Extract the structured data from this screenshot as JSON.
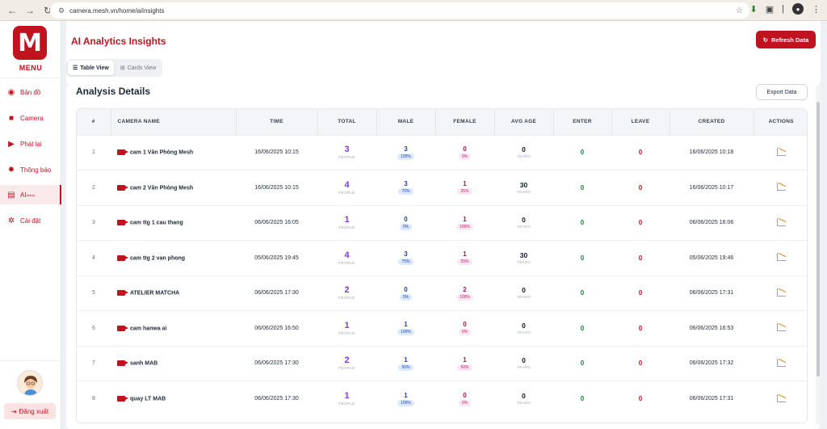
{
  "browser": {
    "url": "camera.mesh.vn/home/aiInsights"
  },
  "sidebar": {
    "logo_letter": "M",
    "menu_title": "MENU",
    "items": [
      {
        "label": "Bản đồ",
        "icon": "map-icon"
      },
      {
        "label": "Camera",
        "icon": "camera-icon"
      },
      {
        "label": "Phát lại",
        "icon": "playback-icon"
      },
      {
        "label": "Thông báo",
        "icon": "bell-icon"
      },
      {
        "label": "AI",
        "badge": "(beta)",
        "icon": "ai-icon"
      },
      {
        "label": "Cài đặt",
        "icon": "gear-icon"
      }
    ],
    "logout_label": "Đăng xuất"
  },
  "header": {
    "title": "AI Analytics Insights",
    "refresh_label": "Refresh Data",
    "views": [
      {
        "label": "Table View",
        "active": true
      },
      {
        "label": "Cards View",
        "active": false
      }
    ]
  },
  "section": {
    "title": "Analysis Details",
    "export_label": "Export Data"
  },
  "table": {
    "columns": [
      "#",
      "CAMERA NAME",
      "TIME",
      "TOTAL",
      "MALE",
      "FEMALE",
      "AVG AGE",
      "ENTER",
      "LEAVE",
      "CREATED",
      "ACTIONS"
    ],
    "unit_people": "PEOPLE",
    "unit_years": "YEARS",
    "rows": [
      {
        "idx": "1",
        "camera": "cam 1 Văn Phòng Mesh",
        "time": "16/06/2025 10:15",
        "total": "3",
        "male": "3",
        "male_pct": "100%",
        "female": "0",
        "female_pct": "0%",
        "age": "0",
        "enter": "0",
        "leave": "0",
        "created": "16/06/2025 10:18"
      },
      {
        "idx": "2",
        "camera": "cam 2 Văn Phòng Mesh",
        "time": "16/06/2025 10:15",
        "total": "4",
        "male": "3",
        "male_pct": "75%",
        "female": "1",
        "female_pct": "25%",
        "age": "30",
        "enter": "0",
        "leave": "0",
        "created": "16/06/2025 10:17"
      },
      {
        "idx": "3",
        "camera": "cam ttg 1 cau thang",
        "time": "06/06/2025 16:05",
        "total": "1",
        "male": "0",
        "male_pct": "0%",
        "female": "1",
        "female_pct": "100%",
        "age": "0",
        "enter": "0",
        "leave": "0",
        "created": "06/06/2025 16:06"
      },
      {
        "idx": "4",
        "camera": "cam ttg 2 van phong",
        "time": "05/06/2025 19:45",
        "total": "4",
        "male": "3",
        "male_pct": "75%",
        "female": "1",
        "female_pct": "25%",
        "age": "30",
        "enter": "0",
        "leave": "0",
        "created": "05/06/2025 19:46"
      },
      {
        "idx": "5",
        "camera": "ATELIER MATCHA",
        "time": "06/06/2025 17:30",
        "total": "2",
        "male": "0",
        "male_pct": "0%",
        "female": "2",
        "female_pct": "100%",
        "age": "0",
        "enter": "0",
        "leave": "0",
        "created": "06/06/2025 17:31"
      },
      {
        "idx": "6",
        "camera": "cam hanwa ai",
        "time": "06/06/2025 16:50",
        "total": "1",
        "male": "1",
        "male_pct": "100%",
        "female": "0",
        "female_pct": "0%",
        "age": "0",
        "enter": "0",
        "leave": "0",
        "created": "06/06/2025 16:53"
      },
      {
        "idx": "7",
        "camera": "sanh MAB",
        "time": "06/06/2025 17:30",
        "total": "2",
        "male": "1",
        "male_pct": "50%",
        "female": "1",
        "female_pct": "50%",
        "age": "0",
        "enter": "0",
        "leave": "0",
        "created": "06/06/2025 17:32"
      },
      {
        "idx": "8",
        "camera": "quay LT MAB",
        "time": "06/06/2025 17:30",
        "total": "1",
        "male": "1",
        "male_pct": "100%",
        "female": "0",
        "female_pct": "0%",
        "age": "0",
        "enter": "0",
        "leave": "0",
        "created": "06/06/2025 17:31"
      }
    ]
  },
  "colors": {
    "brand": "#c1121f",
    "total": "#7c3aed",
    "male": "#1e40af",
    "female": "#9d174d",
    "enter": "#15803d"
  }
}
